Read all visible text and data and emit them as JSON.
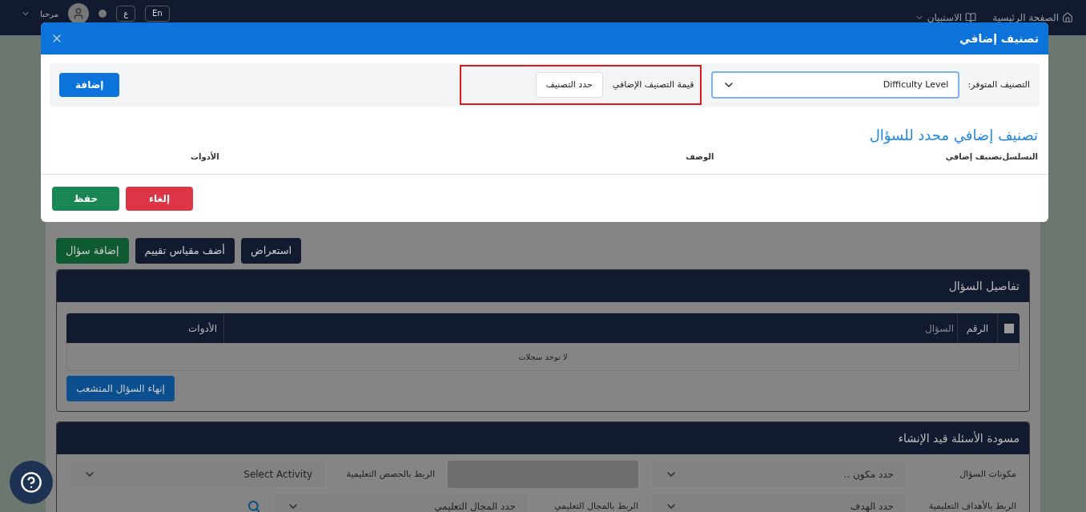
{
  "top_bar": {
    "nav": [
      {
        "label": "الصفحة الرئيسية"
      },
      {
        "label": "الاستبيان"
      }
    ],
    "greeting": "مرحبا",
    "languages": [
      {
        "label": "En"
      },
      {
        "label": "ع"
      }
    ]
  },
  "actions": [
    {
      "label": "استعراض",
      "kind": "navy"
    },
    {
      "label": "أضف مقياس تقييم",
      "kind": "navy"
    },
    {
      "label": "إضافة سؤال",
      "kind": "green"
    }
  ],
  "question_details": {
    "title": "تفاصيل السؤال",
    "select_all": {
      "checked": false
    },
    "columns": [
      "الرقم",
      "السؤال",
      "الأدوات"
    ],
    "empty_text": "لا توجد سجلات",
    "end_button": "إنهاء السؤال المتشعب"
  },
  "drafts": {
    "title": "مسودة الأسئلة قيد الإنشاء",
    "rows": [
      [
        {
          "label": "مكونات السؤال",
          "value": "حدد مكون ..",
          "kind": "select"
        },
        {
          "kind": "disabled"
        },
        {
          "label": "الربط بالحصص التعليمية",
          "value": "Select Activity",
          "kind": "select"
        }
      ],
      [
        {
          "label": "الربط بالأهداف التعليمية",
          "value": "حدد الهدف",
          "kind": "select"
        },
        {
          "label": "الربط بالمجال التعليمي",
          "value": "حدد المجال التعليمي",
          "kind": "select"
        },
        {
          "kind": "search"
        }
      ]
    ]
  },
  "modal": {
    "title": "تصنيف إضافي",
    "available_label": "التصنيف المتوفر:",
    "available_value": "Difficulty Level",
    "value_label": "قيمة التصنيف الإضافي",
    "value_button": "حدد التصنيف",
    "add_button": "إضافة",
    "section_title": "تصنيف إضافي محدد للسؤال",
    "columns": [
      "التسلسل",
      "تصنيف إضافي",
      "الوصف",
      "الأدوات"
    ],
    "cancel_button": "إلغاء",
    "save_button": "حفظ"
  }
}
